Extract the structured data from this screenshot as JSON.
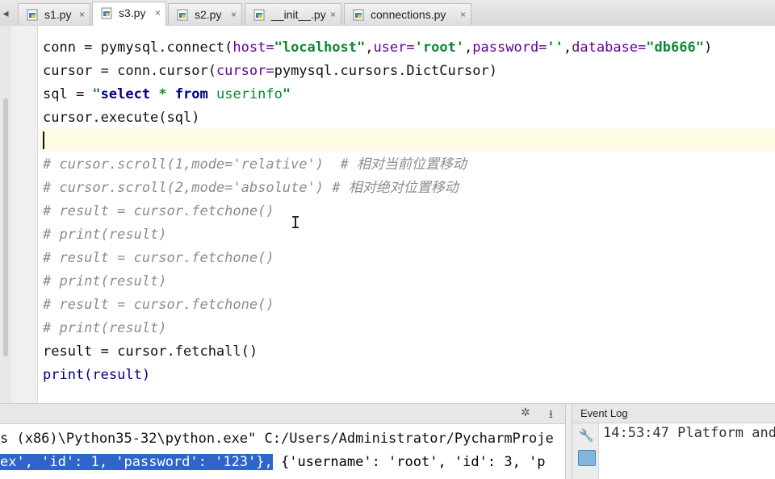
{
  "tabs": [
    {
      "label": "s1.py",
      "close": "×"
    },
    {
      "label": "s3.py",
      "close": "×"
    },
    {
      "label": "s2.py",
      "close": "×"
    },
    {
      "label": "__init__.py",
      "close": "×"
    },
    {
      "label": "connections.py",
      "close": "×"
    }
  ],
  "tabbar": {
    "scroll_left": "◂"
  },
  "code": {
    "l0_a": "conn = pymysql.connect(",
    "l0_p1": "host=",
    "l0_s1": "\"localhost\"",
    "l0_c1": ",",
    "l0_p2": "user=",
    "l0_s2": "'root'",
    "l0_c2": ",",
    "l0_p3": "password=",
    "l0_s3": "''",
    "l0_c3": ",",
    "l0_p4": "database=",
    "l0_s4": "\"db666\"",
    "l0_end": ")",
    "l1_a": "cursor = conn.cursor(",
    "l1_p": "cursor=",
    "l1_b": "pymysql.cursors.DictCursor)",
    "l2_a": "sql = ",
    "l2_q1": "\"",
    "l2_k1": "select",
    "l2_m": " * ",
    "l2_k2": "from",
    "l2_t": " userinfo",
    "l2_q2": "\"",
    "l3": "cursor.execute(sql)",
    "c1": "# cursor.scroll(1,mode='relative')  # 相对当前位置移动",
    "c2": "# cursor.scroll(2,mode='absolute') # 相对绝对位置移动",
    "c3": "# result = cursor.fetchone()",
    "c4": "# print(result)",
    "c5": "# result = cursor.fetchone()",
    "c6": "# print(result)",
    "c7": "# result = cursor.fetchone()",
    "c8": "# print(result)",
    "l_fetchall": "result = cursor.fetchall()",
    "l_print": "print(result)"
  },
  "run": {
    "gear": "✲",
    "hide": "⭳",
    "line1": "s (x86)\\Python35-32\\python.exe\" C:/Users/Administrator/PycharmProje",
    "line2_sel": "ex', 'id': 1, 'password': '123'},",
    "line2_rest": " {'username': 'root', 'id': 3, 'p"
  },
  "event_log": {
    "title": "Event Log",
    "message": "14:53:47 Platform and"
  },
  "colors": {
    "string": "#0b8a33",
    "keyword": "#000080",
    "parameter": "#660099",
    "comment": "#8c8c8c",
    "selection": "#2f65ca"
  },
  "icons": [
    "python-file-icon",
    "close-icon",
    "gear-icon",
    "hide-icon",
    "wrench-icon",
    "message-icon"
  ]
}
